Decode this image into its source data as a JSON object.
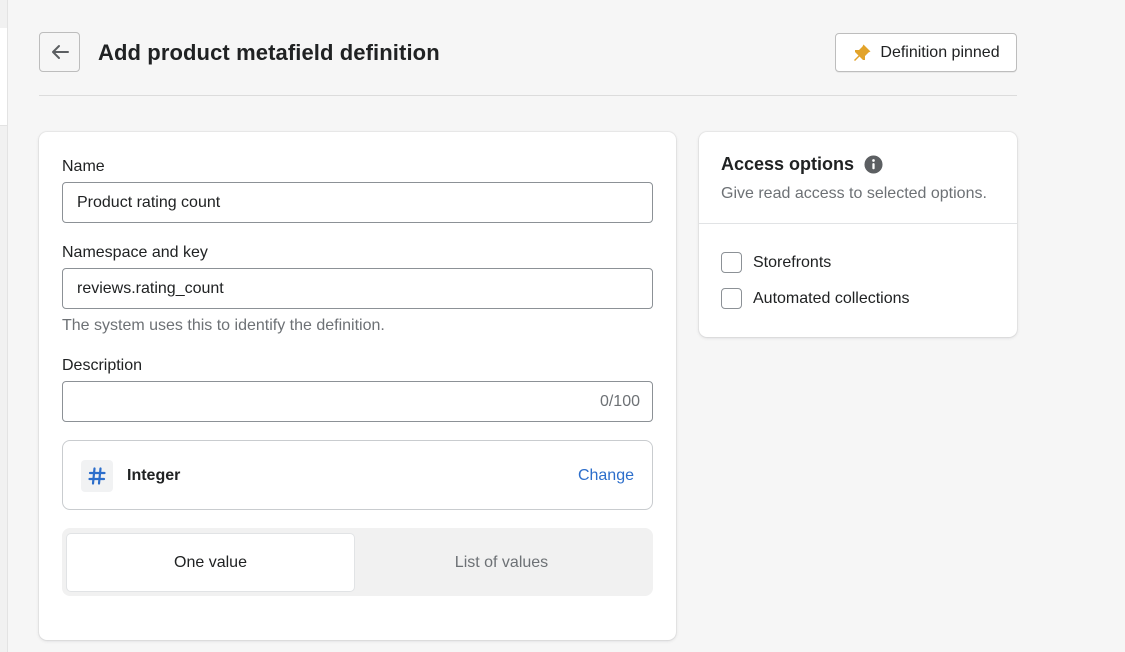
{
  "header": {
    "title": "Add product metafield definition",
    "pin_label": "Definition pinned"
  },
  "form": {
    "name_label": "Name",
    "name_value": "Product rating count",
    "namespace_label": "Namespace and key",
    "namespace_value": "reviews.rating_count",
    "namespace_help": "The system uses this to identify the definition.",
    "description_label": "Description",
    "description_value": "",
    "description_count": "0/100",
    "type_name": "Integer",
    "type_change": "Change",
    "value_mode_options": [
      "One value",
      "List of values"
    ],
    "value_mode_selected": "One value"
  },
  "access": {
    "title": "Access options",
    "subtitle": "Give read access to selected options.",
    "options": [
      {
        "label": "Storefronts",
        "checked": false
      },
      {
        "label": "Automated collections",
        "checked": false
      }
    ]
  },
  "colors": {
    "link": "#2c6ecb",
    "pin_icon": "#e2a32a",
    "type_icon": "#2c6ecb",
    "info_icon": "#5c5f62"
  },
  "icons": {
    "back": "arrow-left-icon",
    "pin": "pin-icon",
    "type": "hashtag-icon",
    "info": "info-icon"
  }
}
